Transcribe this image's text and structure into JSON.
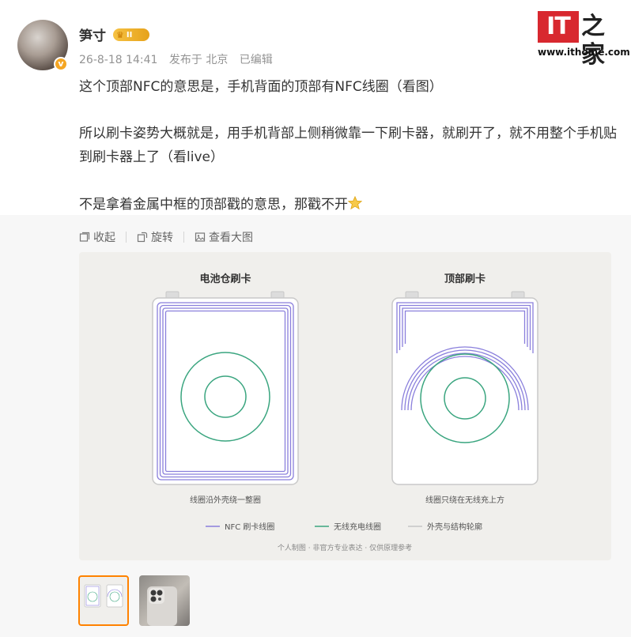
{
  "post": {
    "username": "笋寸",
    "vip_level": "II",
    "date": "26-8-18 14:41",
    "location": "发布于 北京",
    "edited": "已编辑",
    "paragraphs": [
      "这个顶部NFC的意思是，手机背面的顶部有NFC线圈（看图）",
      "所以刷卡姿势大概就是，用手机背部上侧稍微靠一下刷卡器，就刷开了，就不用整个手机贴到刷卡器上了（看live）",
      "不是拿着金属中框的顶部戳的意思，那戳不开"
    ]
  },
  "logo": {
    "mark": "IT",
    "name": "之家",
    "url": "www.ithome.com"
  },
  "toolbar": {
    "collapse": "收起",
    "rotate": "旋转",
    "view_large": "查看大图"
  },
  "figure": {
    "left_title": "电池仓刷卡",
    "right_title": "顶部刷卡",
    "left_caption": "线圈沿外壳绕一整圈",
    "right_caption": "线圈只绕在无线充上方",
    "legend": [
      {
        "label": "NFC 刷卡线圈",
        "color": "#8a7fdc"
      },
      {
        "label": "无线充电线圈",
        "color": "#3aa57f"
      },
      {
        "label": "外壳与结构轮廓",
        "color": "#c5c5c5"
      }
    ],
    "footnote": "个人制图 · 非官方专业表达 · 仅供原理参考"
  },
  "thumbnails": [
    "diagram",
    "photo"
  ]
}
